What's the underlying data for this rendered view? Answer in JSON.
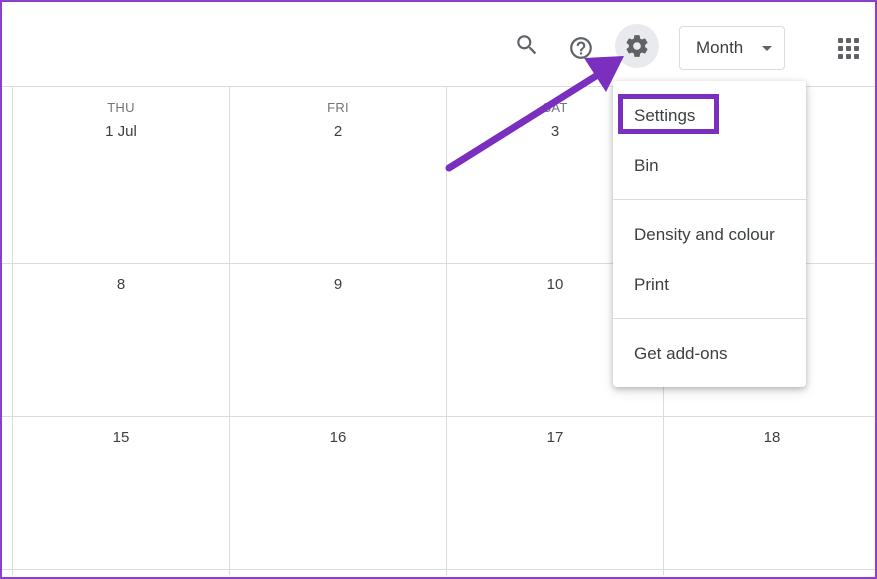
{
  "header": {
    "icons": [
      "search-icon",
      "help-icon",
      "settings-gear-icon",
      "apps-grid-icon"
    ],
    "view_selector": {
      "selected": "Month"
    }
  },
  "calendar": {
    "columns": [
      {
        "dow": "THU",
        "dates": [
          "1 Jul",
          "8",
          "15"
        ]
      },
      {
        "dow": "FRI",
        "dates": [
          "2",
          "9",
          "16"
        ]
      },
      {
        "dow": "SAT",
        "dates": [
          "3",
          "10",
          "17"
        ]
      },
      {
        "dow": "",
        "dates": [
          "",
          "",
          "18"
        ]
      }
    ]
  },
  "settings_menu": {
    "items": [
      "Settings",
      "Bin",
      "Density and colour",
      "Print",
      "Get add-ons"
    ],
    "highlighted_item": "Settings"
  },
  "annotation": {
    "arrow_color": "#7b2fbe",
    "highlight_color": "#7b2fbe"
  }
}
